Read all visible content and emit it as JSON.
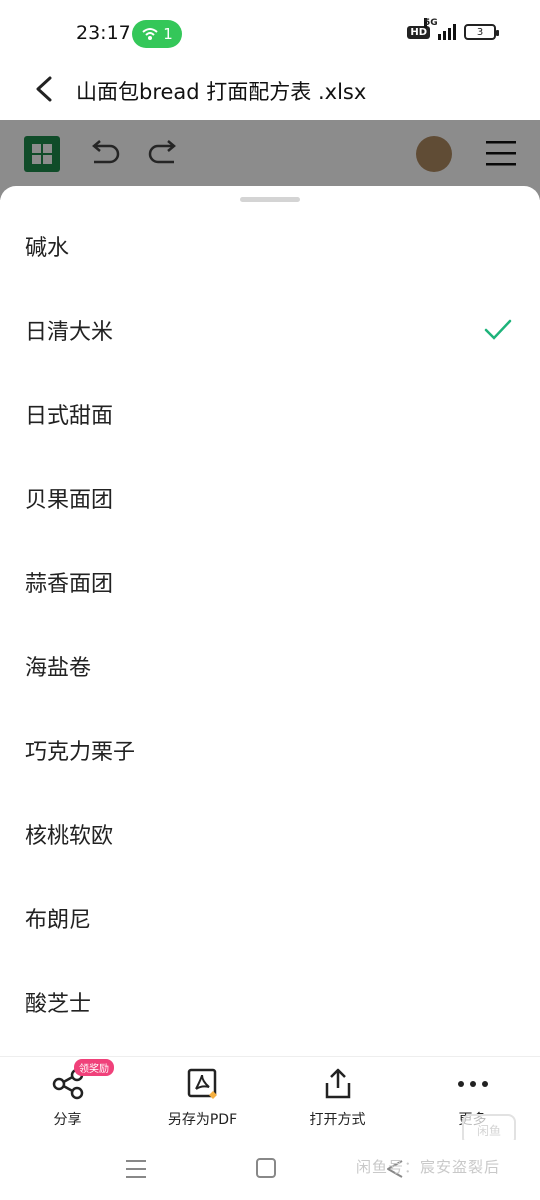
{
  "status_bar": {
    "time": "23:17",
    "hotspot_count": "1",
    "hd": "HD",
    "network": "5G",
    "battery": "3"
  },
  "title_bar": {
    "title": "山面包bread 打面配方表  .xlsx"
  },
  "list": {
    "items": [
      {
        "label": "碱水",
        "selected": false
      },
      {
        "label": "日清大米",
        "selected": true
      },
      {
        "label": "日式甜面",
        "selected": false
      },
      {
        "label": "贝果面团",
        "selected": false
      },
      {
        "label": "蒜香面团",
        "selected": false
      },
      {
        "label": "海盐卷",
        "selected": false
      },
      {
        "label": "巧克力栗子",
        "selected": false
      },
      {
        "label": "核桃软欧",
        "selected": false
      },
      {
        "label": "布朗尼",
        "selected": false
      },
      {
        "label": "酸芝士",
        "selected": false
      }
    ]
  },
  "actions": {
    "share": {
      "label": "分享",
      "badge": "领奖励"
    },
    "save_pdf": {
      "label": "另存为PDF"
    },
    "open_with": {
      "label": "打开方式"
    },
    "more": {
      "label": "更多"
    }
  },
  "watermark": {
    "text": "闲鱼号：宸安盗裂后",
    "logo": "闲鱼"
  },
  "colors": {
    "accent_green": "#1db37a",
    "app_green": "#1e8a4c",
    "badge_pink": "#f0417a"
  }
}
